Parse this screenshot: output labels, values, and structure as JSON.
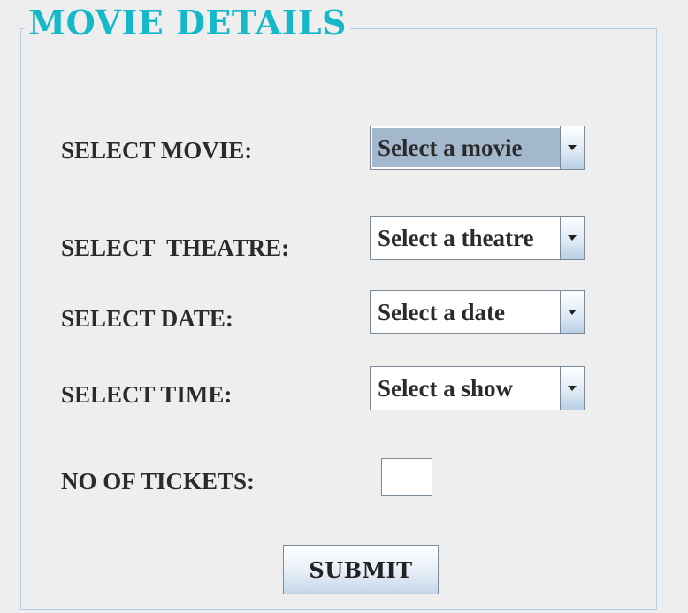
{
  "panel": {
    "title": "MOVIE DETAILS"
  },
  "fields": {
    "movie": {
      "label": "SELECT MOVIE:",
      "value": "Select a movie"
    },
    "theatre": {
      "label": "SELECT  THEATRE:",
      "value": "Select a theatre"
    },
    "date": {
      "label": "SELECT DATE:",
      "value": "Select a date"
    },
    "time": {
      "label": "SELECT TIME:",
      "value": "Select a show"
    },
    "tickets": {
      "label": "NO OF TICKETS:",
      "value": ""
    }
  },
  "submit": {
    "label": "SUBMIT"
  },
  "colors": {
    "title": "#14b8c8",
    "background": "#eeeeee",
    "border": "#b8cfe5",
    "selection": "#a3b8cc",
    "text": "#2b2b2b"
  },
  "icons": {
    "combo_arrow": "chevron-down-icon"
  }
}
